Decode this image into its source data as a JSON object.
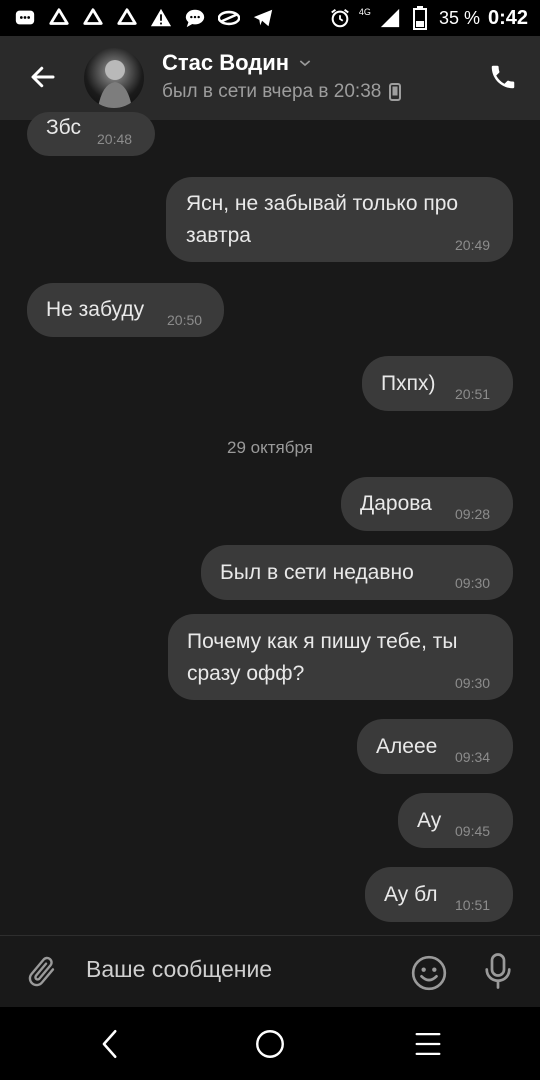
{
  "status_bar": {
    "network": "4G",
    "battery": "35 %",
    "time": "0:42"
  },
  "header": {
    "contact_name": "Стас Водин",
    "last_seen": "был в сети вчера в 20:38"
  },
  "messages": [
    {
      "text": "Збс",
      "time": "20:48",
      "side": "in"
    },
    {
      "text": "Ясн, не забывай только про\nзавтра",
      "time": "20:49",
      "side": "out"
    },
    {
      "text": "Не забуду",
      "time": "20:50",
      "side": "in"
    },
    {
      "text": "Пхпх)",
      "time": "20:51",
      "side": "out"
    },
    {
      "text": "Дарова",
      "time": "09:28",
      "side": "out"
    },
    {
      "text": "Был в сети недавно",
      "time": "09:30",
      "side": "out"
    },
    {
      "text": "Почему как я пишу тебе, ты\nсразу офф?",
      "time": "09:30",
      "side": "out"
    },
    {
      "text": "Алеее",
      "time": "09:34",
      "side": "out"
    },
    {
      "text": "Ау",
      "time": "09:45",
      "side": "out"
    },
    {
      "text": "Ау бл",
      "time": "10:51",
      "side": "out"
    }
  ],
  "date_separator": "29 октября",
  "composer": {
    "placeholder": "Ваше сообщение"
  },
  "colors": {
    "background": "#191919",
    "header": "#2a2a2a",
    "bubble": "#3a3a3a"
  },
  "icons": [
    "back-arrow-icon",
    "chevron-down-icon",
    "phone-icon",
    "attach-icon",
    "emoji-icon",
    "mic-icon"
  ]
}
